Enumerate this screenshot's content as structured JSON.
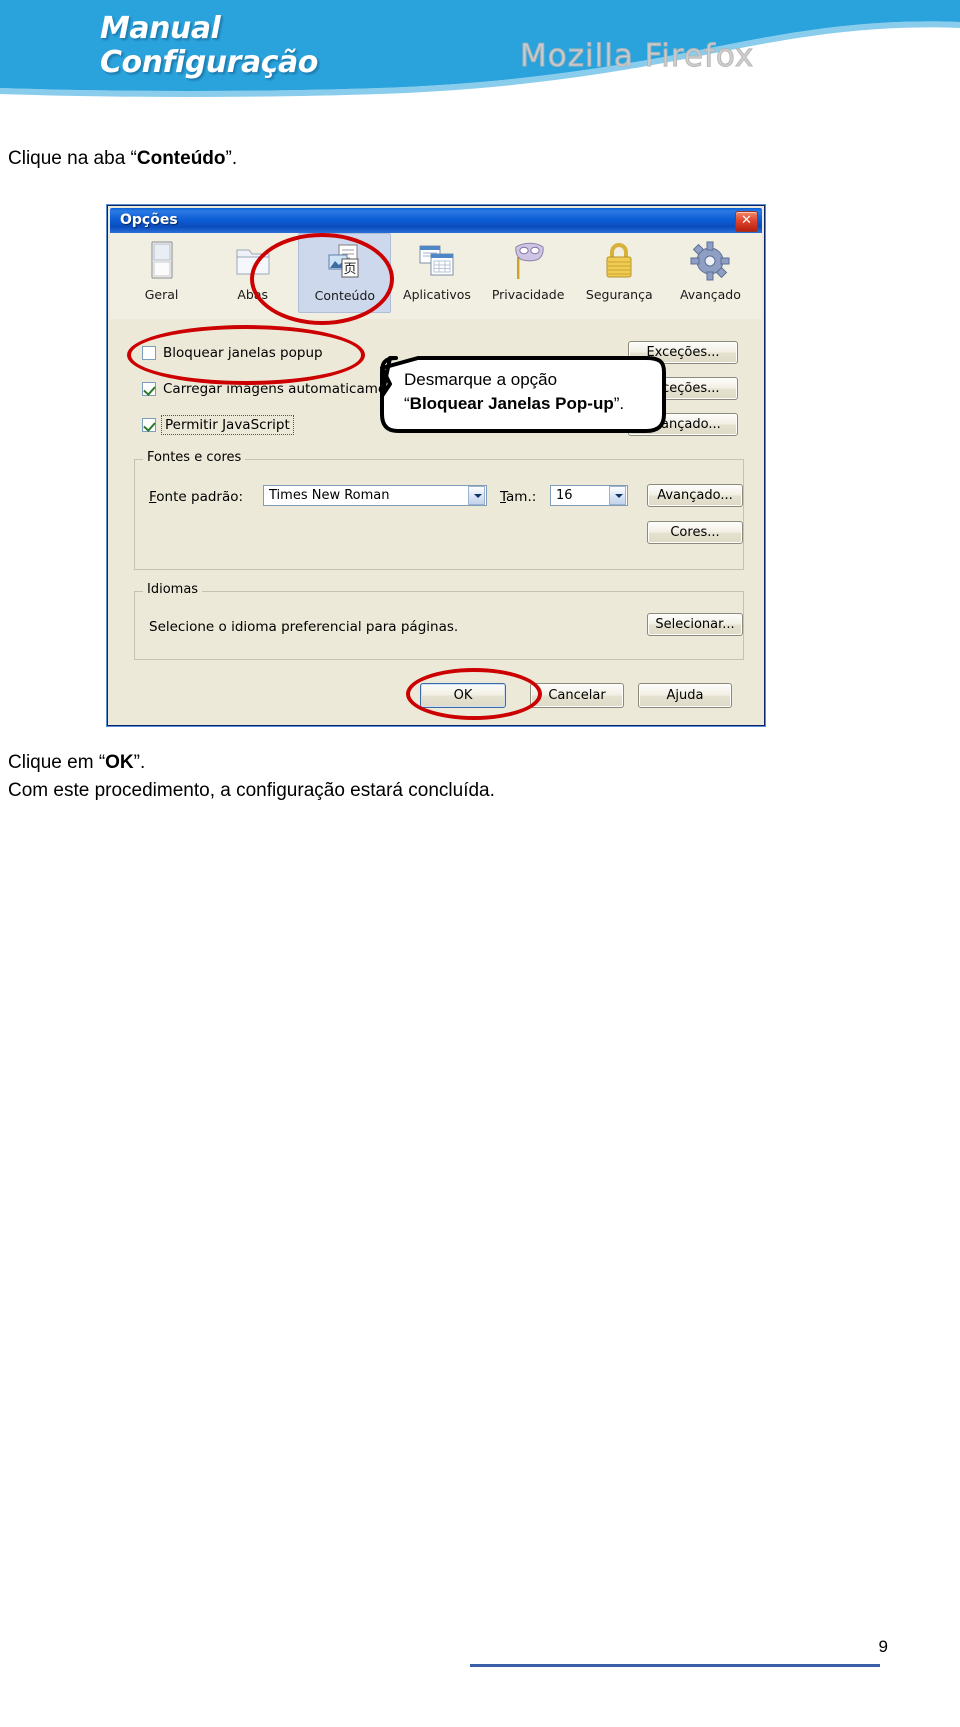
{
  "banner": {
    "title_line1": "Manual",
    "title_line2": "Configuração",
    "brand": "Mozilla Firefox"
  },
  "instructions": {
    "top_prefix": "Clique na aba “",
    "top_bold": "Conteúdo",
    "top_suffix": "”.",
    "ok_prefix": "Clique em “",
    "ok_bold": "OK",
    "ok_suffix": "”.",
    "ok_line2": "Com este procedimento, a configuração estará concluída."
  },
  "dialog": {
    "title": "Opções",
    "close_label": "✕",
    "tabs": [
      {
        "label": "Geral",
        "icon": "general-window-icon",
        "selected": false
      },
      {
        "label": "Abas",
        "icon": "tabs-folder-icon",
        "selected": false
      },
      {
        "label": "Conteúdo",
        "icon": "content-page-icon",
        "selected": true
      },
      {
        "label": "Aplicativos",
        "icon": "applications-windows-icon",
        "selected": false
      },
      {
        "label": "Privacidade",
        "icon": "privacy-mask-icon",
        "selected": false
      },
      {
        "label": "Segurança",
        "icon": "security-padlock-icon",
        "selected": false
      },
      {
        "label": "Avançado",
        "icon": "advanced-gear-icon",
        "selected": false
      }
    ],
    "checkboxes": [
      {
        "label": "Bloquear janelas popup",
        "accel": "B",
        "checked": false,
        "focused": false
      },
      {
        "label": "Carregar imagens automaticamente",
        "accel": "C",
        "checked": true,
        "focused": false
      },
      {
        "label": "Permitir JavaScript",
        "accel": "P",
        "checked": true,
        "focused": true
      }
    ],
    "right_buttons_top": [
      {
        "label": "Exceções..."
      },
      {
        "label": "Exceções..."
      },
      {
        "label": "Avançado..."
      }
    ],
    "fonts_group": {
      "legend": "Fontes e cores",
      "font_label": "Fonte padrão:",
      "font_value": "Times New Roman",
      "size_label": "Tam.:",
      "size_value": "16",
      "advanced_button": "Avançado...",
      "colors_button": "Cores..."
    },
    "languages_group": {
      "legend": "Idiomas",
      "description": "Selecione o idioma preferencial para páginas.",
      "select_button": "Selecionar..."
    },
    "footer_buttons": [
      {
        "label": "OK",
        "default": true
      },
      {
        "label": "Cancelar",
        "default": false
      },
      {
        "label": "Ajuda",
        "default": false
      }
    ]
  },
  "callout": {
    "line1": "Desmarque a opção",
    "line2_quote_open": "“",
    "line2_bold": "Bloquear Janelas Pop-up",
    "line2_quote_close": "”."
  },
  "page": {
    "number": "9"
  },
  "colors": {
    "banner_blue": "#2aa3dd",
    "annotation_red": "#cc0000",
    "dialog_face": "#ece9d8",
    "titlebar_blue": "#0a5fd4",
    "footer_rule": "#3a5fa8"
  }
}
